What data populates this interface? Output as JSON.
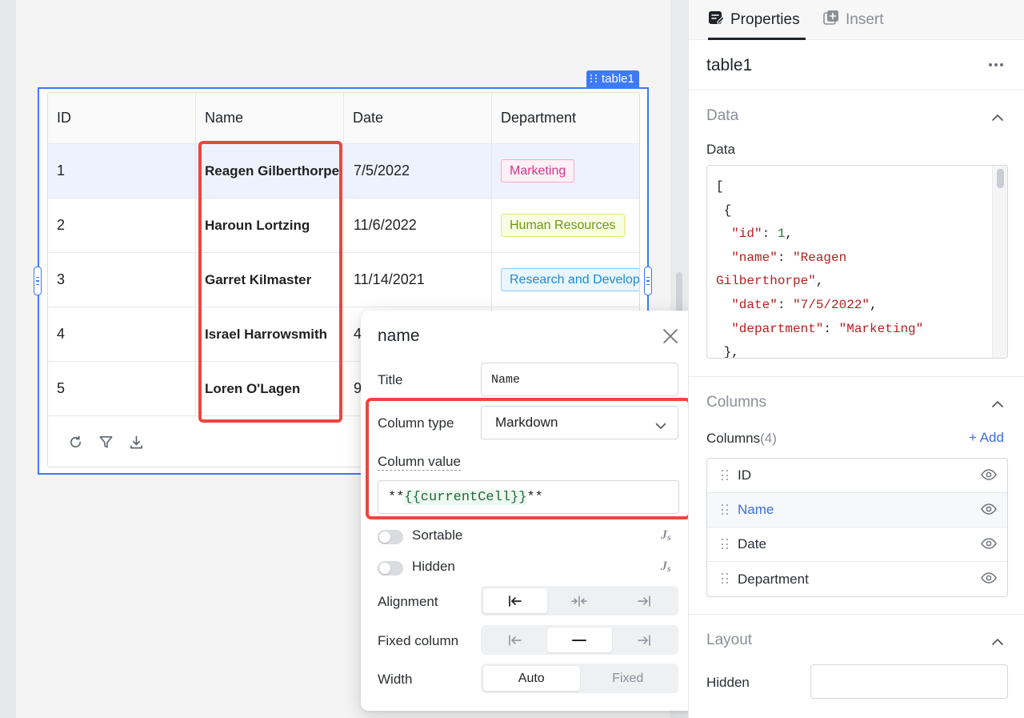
{
  "widget": {
    "tag_label": "table1"
  },
  "table": {
    "headers": [
      "ID",
      "Name",
      "Date",
      "Department"
    ],
    "rows": [
      {
        "id": "1",
        "name": "Reagen Gilberthorpe",
        "date": "7/5/2022",
        "department": "Marketing",
        "tag_color": "pink"
      },
      {
        "id": "2",
        "name": "Haroun Lortzing",
        "date": "11/6/2022",
        "department": "Human Resources",
        "tag_color": "lime"
      },
      {
        "id": "3",
        "name": "Garret Kilmaster",
        "date": "11/14/2021",
        "department": "Research and Development",
        "tag_color": "blue"
      },
      {
        "id": "4",
        "name": "Israel Harrowsmith",
        "date": "4",
        "department": "",
        "tag_color": ""
      },
      {
        "id": "5",
        "name": "Loren O'Lagen",
        "date": "9",
        "department": "",
        "tag_color": ""
      }
    ],
    "toolbar_icons": [
      "refresh-icon",
      "filter-icon",
      "download-icon"
    ]
  },
  "popup": {
    "title": "name",
    "title_label": "Title",
    "title_value": "Name",
    "column_type_label": "Column type",
    "column_type_value": "Markdown",
    "column_value_label": "Column value",
    "column_value_prefix": "**",
    "column_value_expr": "{{currentCell}}",
    "column_value_suffix": "**",
    "sortable_label": "Sortable",
    "hidden_label": "Hidden",
    "js_label": "JS",
    "alignment_label": "Alignment",
    "fixed_column_label": "Fixed column",
    "width_label": "Width",
    "width_options": [
      "Auto",
      "Fixed"
    ]
  },
  "panel": {
    "tab_properties": "Properties",
    "tab_insert": "Insert",
    "component_name": "table1",
    "data_section_title": "Data",
    "data_label": "Data",
    "data_code_lines": [
      "[",
      " {",
      "  \"id\": 1,",
      "  \"name\": \"Reagen",
      "Gilberthorpe\",",
      "  \"date\": \"7/5/2022\",",
      "  \"department\": \"Marketing\"",
      " },"
    ],
    "columns_section_title": "Columns",
    "columns_label": "Columns",
    "columns_count": "(4)",
    "add_label": "+ Add",
    "columns": [
      "ID",
      "Name",
      "Date",
      "Department"
    ],
    "active_column": "Name",
    "layout_section_title": "Layout",
    "hidden_label": "Hidden"
  },
  "colors": {
    "accent": "#3d7af5",
    "highlight": "#e8483e",
    "link": "#3d6ee6"
  }
}
